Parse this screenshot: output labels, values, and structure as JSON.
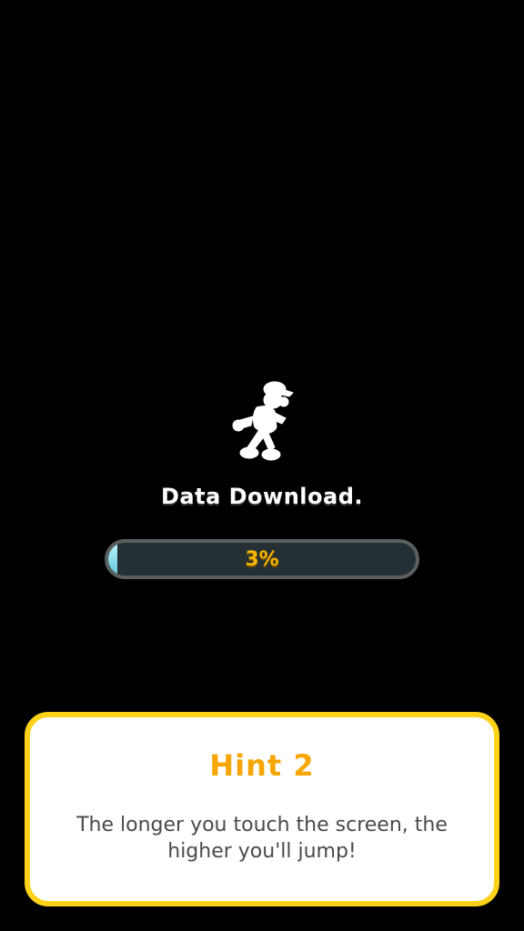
{
  "loading": {
    "title": "Data Download.",
    "progress_percent": 3,
    "progress_label": "3%",
    "character_icon": "running-character-silhouette-icon"
  },
  "hint": {
    "title": "Hint 2",
    "text": "The longer you touch the screen, the higher you'll jump!"
  },
  "colors": {
    "background": "#000000",
    "progress_track": "#243034",
    "progress_border": "#5a5f60",
    "progress_fill": "#5cc7dc",
    "progress_text": "#f7b500",
    "hint_border": "#ffd21a",
    "hint_title": "#f7a500",
    "hint_text": "#4a4a4a"
  }
}
